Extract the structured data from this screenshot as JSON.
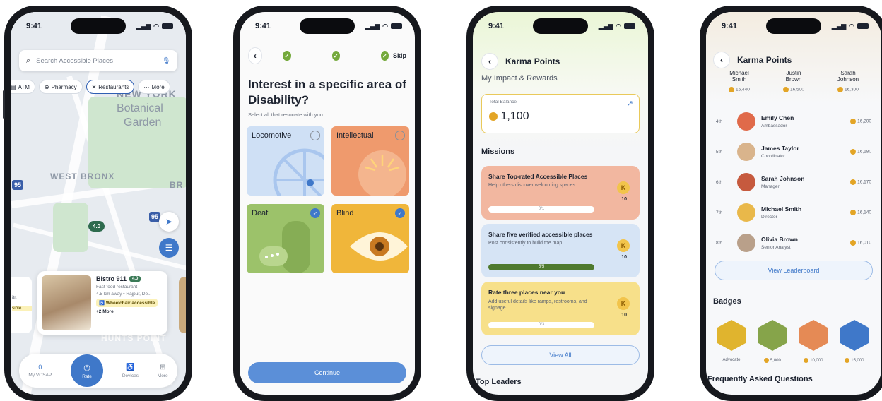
{
  "status_time": "9:41",
  "phone1": {
    "search_placeholder": "Search Accessible Places",
    "chips": [
      "ATM",
      "Pharmacy",
      "Restaurants",
      "More"
    ],
    "map_labels": {
      "area1": "NEW YORK",
      "area2": "Botanical",
      "area3": "Garden",
      "area4": "WEST BRONX",
      "area5": "BR",
      "area6": "HUNTS POINT",
      "shield1": "95",
      "shield2": "95",
      "pin": "4.0"
    },
    "card": {
      "name": "Bistro 911",
      "rating": "4.0",
      "type": "Fast food restaurant",
      "meta": "4.5 km away • Rajpur, De...",
      "access": "Wheelchair accessible",
      "more": "+2 More",
      "left_peek1": "itr.",
      "left_peek2": "sible"
    },
    "nav": [
      "My VOSAP",
      "Rate",
      "Devices",
      "More"
    ],
    "nav_count": "0"
  },
  "phone2": {
    "skip": "Skip",
    "question": "Interest in a specific area of Disability?",
    "subtitle": "Select all that resonate with you",
    "tiles": [
      {
        "label": "Locomotive",
        "selected": false,
        "color": "#cfe0f5"
      },
      {
        "label": "Intellectual",
        "selected": false,
        "color": "#ef9a6d"
      },
      {
        "label": "Deaf",
        "selected": true,
        "color": "#9cc26a"
      },
      {
        "label": "Blind",
        "selected": true,
        "color": "#f0b63a"
      }
    ],
    "continue": "Continue"
  },
  "phone3": {
    "title": "Karma Points",
    "section": "My Impact & Rewards",
    "balance_label": "Total Balance",
    "balance": "1,100",
    "missions_title": "Missions",
    "missions": [
      {
        "title": "Share Top-rated Accessible Places",
        "desc": "Help others discover welcoming spaces.",
        "progress_text": "0/1",
        "progress": 0,
        "points": "10",
        "color": "#f2b7a0"
      },
      {
        "title": "Share five verified accessible places",
        "desc": "Post consistently to build the map.",
        "progress_text": "5/5",
        "progress": 1,
        "points": "10",
        "color": "#d6e4f5"
      },
      {
        "title": "Rate three places near you",
        "desc": "Add useful details like ramps, restrooms, and signage.",
        "progress_text": "0/3",
        "progress": 0,
        "points": "10",
        "color": "#f7e08a"
      }
    ],
    "view_all": "View All",
    "top_leaders": "Top Leaders"
  },
  "phone4": {
    "title": "Karma Points",
    "top3": [
      {
        "first": "Michael",
        "last": "Smith",
        "points": "16,440"
      },
      {
        "first": "Justin",
        "last": "Brown",
        "points": "16,500"
      },
      {
        "first": "Sarah",
        "last": "Johnson",
        "points": "16,300"
      }
    ],
    "leaders": [
      {
        "rank": "4th",
        "name": "Emily Chen",
        "role": "Ambassador",
        "points": "16,200",
        "color": "#e06a4a"
      },
      {
        "rank": "5th",
        "name": "James Taylor",
        "role": "Coordinator",
        "points": "16,180",
        "color": "#d9b48c"
      },
      {
        "rank": "6th",
        "name": "Sarah Johnson",
        "role": "Manager",
        "points": "16,170",
        "color": "#c65a3e"
      },
      {
        "rank": "7th",
        "name": "Michael Smith",
        "role": "Director",
        "points": "16,140",
        "color": "#e9b84a"
      },
      {
        "rank": "8th",
        "name": "Olivia Brown",
        "role": "Senior Analyst",
        "points": "16,010",
        "color": "#b9a08a"
      }
    ],
    "view_leaderboard": "View Leaderboard",
    "badges_title": "Badges",
    "badges": [
      {
        "label": "Advocate",
        "color": "#e0b42e"
      },
      {
        "label": "5,000",
        "color": "#86a44a"
      },
      {
        "label": "10,000",
        "color": "#e58a55"
      },
      {
        "label": "15,000",
        "color": "#3f78c9"
      }
    ],
    "faq": "Frequently Asked Questions"
  }
}
